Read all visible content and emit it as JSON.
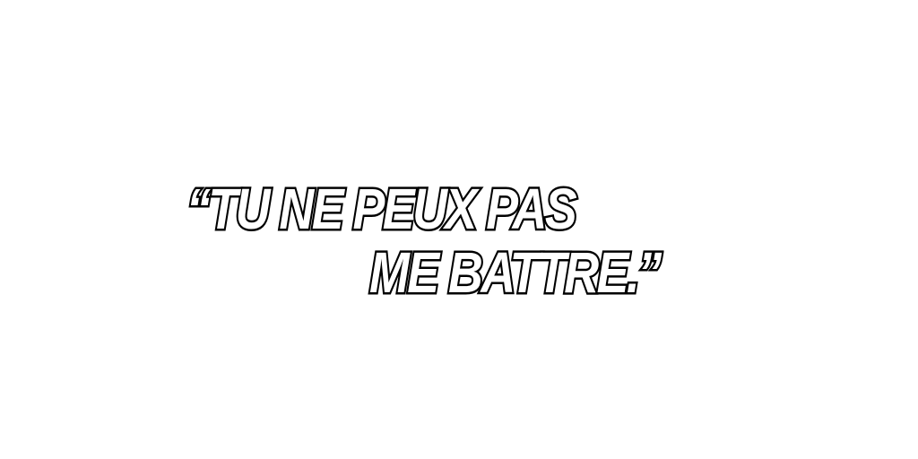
{
  "quote": {
    "line1": "“TU NE PEUX PAS",
    "line2": "ME BATTRE.”"
  },
  "colors": {
    "background": "#ffffff",
    "text_fill": "#ffffff",
    "text_outline": "#000000"
  }
}
